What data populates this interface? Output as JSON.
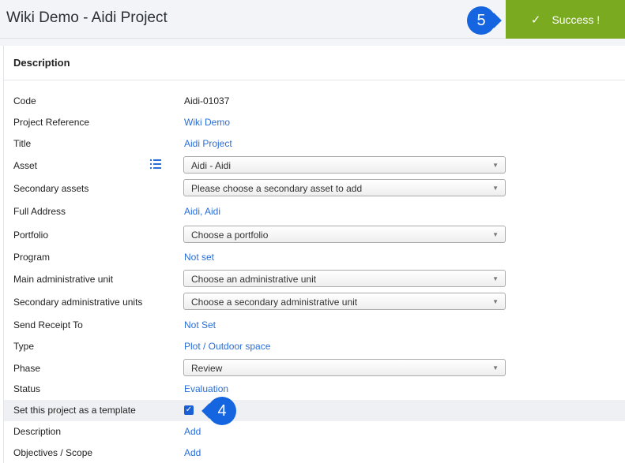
{
  "header": {
    "title": "Wiki Demo - Aidi Project",
    "success_text": "Success !",
    "success_icon": "check-icon",
    "success_color": "#7aaa1f"
  },
  "markers": {
    "five": "5",
    "four": "4"
  },
  "panel": {
    "title": "Description"
  },
  "fields": {
    "code": {
      "label": "Code",
      "value": "Aidi-01037"
    },
    "project_reference": {
      "label": "Project Reference",
      "value": "Wiki Demo"
    },
    "title": {
      "label": "Title",
      "value": "Aidi Project"
    },
    "asset": {
      "label": "Asset",
      "value": "Aidi - Aidi"
    },
    "secondary_assets": {
      "label": "Secondary assets",
      "value": "Please choose a secondary asset to add"
    },
    "full_address": {
      "label": "Full Address",
      "value": "Aidi, Aidi"
    },
    "portfolio": {
      "label": "Portfolio",
      "value": "Choose a portfolio"
    },
    "program": {
      "label": "Program",
      "value": "Not set"
    },
    "main_admin_unit": {
      "label": "Main administrative unit",
      "value": "Choose an administrative unit"
    },
    "secondary_admin_units": {
      "label": "Secondary administrative units",
      "value": "Choose a secondary administrative unit"
    },
    "send_receipt_to": {
      "label": "Send Receipt To",
      "value": "Not Set"
    },
    "type": {
      "label": "Type",
      "value": "Plot / Outdoor space"
    },
    "phase": {
      "label": "Phase",
      "value": "Review"
    },
    "status": {
      "label": "Status",
      "value": "Evaluation"
    },
    "template": {
      "label": "Set this project as a template",
      "checked": true
    },
    "description": {
      "label": "Description",
      "value": "Add"
    },
    "objectives": {
      "label": "Objectives / Scope",
      "value": "Add"
    }
  }
}
